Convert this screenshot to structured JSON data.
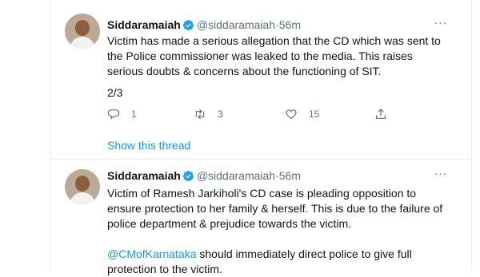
{
  "colors": {
    "accent": "#1b95e0",
    "muted": "#5b7083",
    "verified": "#1da1f2"
  },
  "tweets": [
    {
      "author": {
        "name": "Siddaramaiah",
        "handle": "@siddaramaiah",
        "dot": "·",
        "time": "56m"
      },
      "more": "···",
      "paragraphs": [
        "Victim has made a serious allegation that the CD which was sent to the Police commissioner was leaked to the media. This raises serious doubts & concerns about the functioning of SIT."
      ],
      "thread_counter": "2/3",
      "stats": {
        "replies": "1",
        "retweets": "3",
        "likes": "15"
      },
      "show_thread": "Show this thread"
    },
    {
      "author": {
        "name": "Siddaramaiah",
        "handle": "@siddaramaiah",
        "dot": "·",
        "time": "56m"
      },
      "more": "···",
      "paragraphs": [
        "Victim of Ramesh Jarkiholi's CD case is pleading opposition to ensure protection to her family & herself. This is due to the failure of police department & prejudice towards the victim."
      ],
      "mention": "@CMofKarnataka",
      "mention_text": " should immediately direct police to give full protection to the victim."
    }
  ]
}
